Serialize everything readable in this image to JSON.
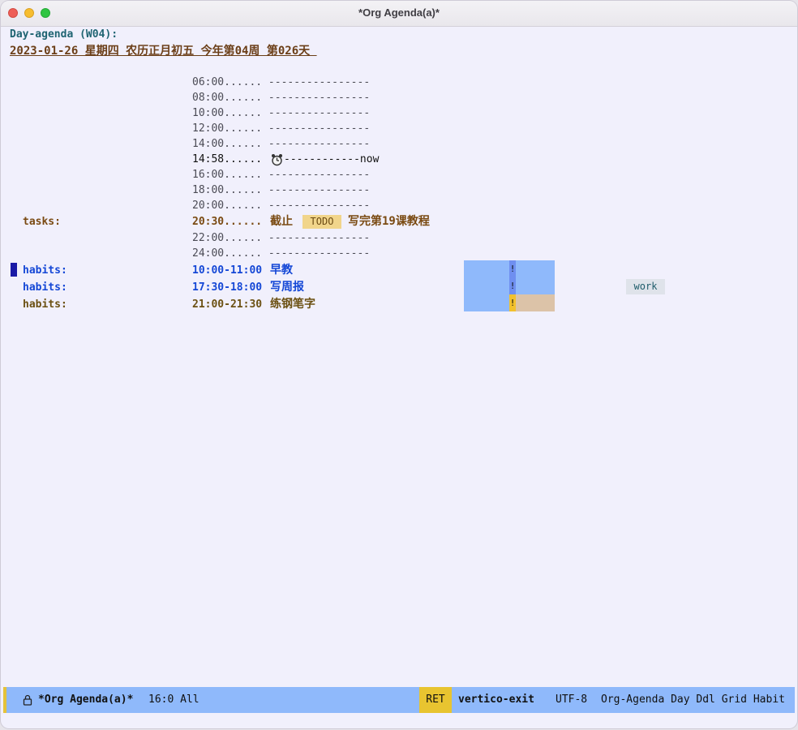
{
  "window": {
    "title": "*Org Agenda(a)*"
  },
  "agenda": {
    "header": "Day-agenda (W04):",
    "date_line": "2023-01-26 星期四 农历正月初五 今年第04周 第026天 ",
    "grid_lines": [
      "06:00...... ----------------",
      "08:00...... ----------------",
      "10:00...... ----------------",
      "12:00...... ----------------",
      "14:00...... ----------------"
    ],
    "now_time": "14:58......",
    "now_text": "------------now",
    "grid_lines_after": [
      "16:00...... ----------------",
      "18:00...... ----------------",
      "20:00...... ----------------"
    ],
    "task": {
      "category": "tasks:",
      "time": "20:30......",
      "prefix": "截止",
      "keyword": "TODO",
      "title": "写完第19课教程"
    },
    "grid_lines_end": [
      "22:00...... ----------------",
      "24:00...... ----------------"
    ],
    "habits": [
      {
        "category": "habits:",
        "time": "10:00-11:00",
        "title": "早教",
        "mark": "!"
      },
      {
        "category": "habits:",
        "time": "17:30-18:00",
        "title": "写周报",
        "mark": "!"
      },
      {
        "category": "habits:",
        "time": "21:00-21:30",
        "title": "练钢笔字",
        "mark": "!"
      }
    ],
    "tag_work": "work"
  },
  "modeline": {
    "buffer": "*Org Agenda(a)*",
    "position": "16:0 All",
    "ret": "RET",
    "command": "vertico-exit",
    "encoding": "UTF-8",
    "modes": "Org-Agenda Day Ddl Grid Habit"
  },
  "colors": {
    "background": "#f1f0fc",
    "modeline": "#8fb9fb",
    "todo_badge": "#f1d58b",
    "habit_blue": "#8fb9fb",
    "habit_mark": "#6f8ff0",
    "habit_warn": "#f2c12e",
    "habit_tan": "#dcc3a8"
  },
  "icons": {
    "alarm": "alarm-clock-icon",
    "lock": "lock-icon"
  }
}
